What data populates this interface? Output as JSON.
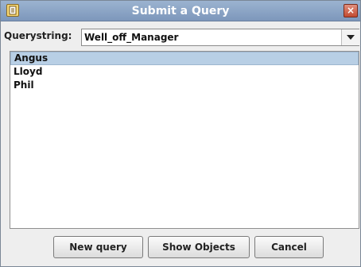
{
  "window": {
    "title": "Submit a Query",
    "close_glyph": "×",
    "icon": "app-document-icon"
  },
  "query": {
    "label": "Querystring:",
    "value": "Well_off_Manager"
  },
  "results": {
    "items": [
      "Angus",
      "Lloyd",
      "Phil"
    ],
    "selected_index": 0
  },
  "buttons": {
    "new_query": "New query",
    "show_objects": "Show Objects",
    "cancel": "Cancel"
  },
  "colors": {
    "titlebar": "#8aa3c6",
    "selection": "#b8cfe5",
    "close": "#c24a30"
  }
}
